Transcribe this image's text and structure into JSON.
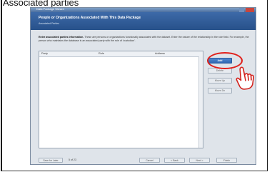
{
  "caption": "Associated parties",
  "window": {
    "title": "Data Package Wizard",
    "header_title": "People or Organizations Associated With This Data Package",
    "header_subtitle": "Associated Parties",
    "instruction_bold": "Enter associated parties information.",
    "instruction_rest": " These are persons or organizations functionally associated with the dataset. Enter the nature of the relationship in the role field. For example, the person who maintains the database is an associated party with the role of 'custodian'."
  },
  "table": {
    "columns": [
      "Party",
      "Role",
      "Address"
    ]
  },
  "buttons": {
    "add": "Add",
    "delete": "Delete",
    "move_up": "Move Up",
    "move_down": "Move Dn"
  },
  "footer": {
    "save_later": "Save for Later",
    "step": "5 of 23",
    "cancel": "Cancel",
    "back": "< Back",
    "next": "Next >",
    "finish": "Finish"
  },
  "colors": {
    "header": "#2f5f9c",
    "highlight": "#e0201b",
    "add_button": "#3a73bf"
  },
  "icons": {
    "pointer": "pointing-hand-icon"
  }
}
